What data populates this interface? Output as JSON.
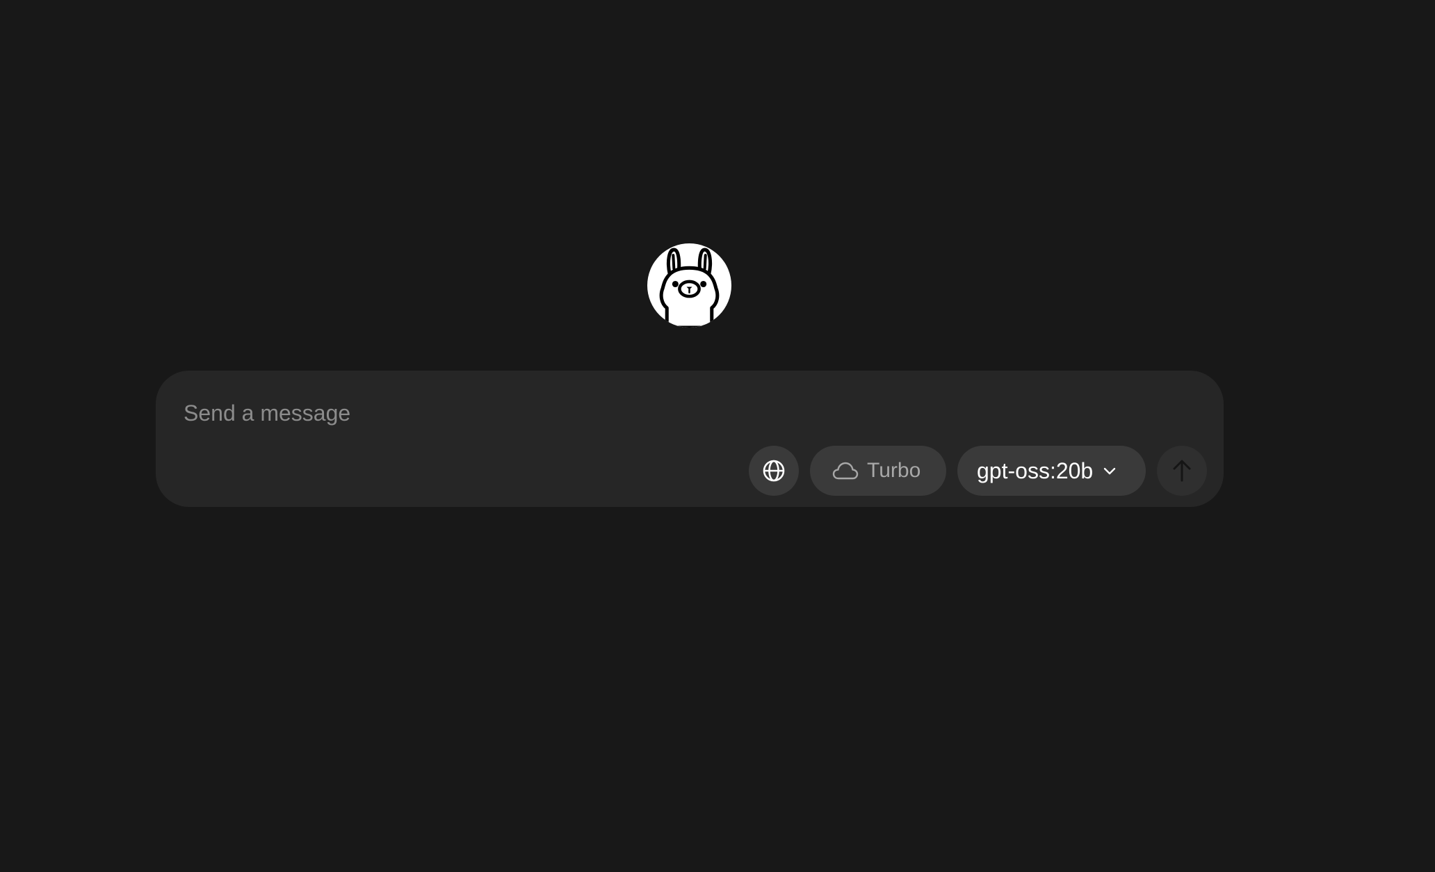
{
  "app": {
    "logo_icon": "llama-logo-icon"
  },
  "composer": {
    "placeholder": "Send a message",
    "value": "",
    "web_search_icon": "globe-icon",
    "turbo": {
      "icon": "cloud-icon",
      "label": "Turbo"
    },
    "model": {
      "selected": "gpt-oss:20b",
      "icon": "chevron-down-icon"
    },
    "send_icon": "arrow-up-icon"
  },
  "colors": {
    "background": "#181818",
    "composer_bg": "#262626",
    "button_bg": "#3a3a3a",
    "send_bg": "#2f2f2f",
    "placeholder": "#8c8c8c",
    "muted_text": "#a8a8a8",
    "text": "#ffffff"
  }
}
